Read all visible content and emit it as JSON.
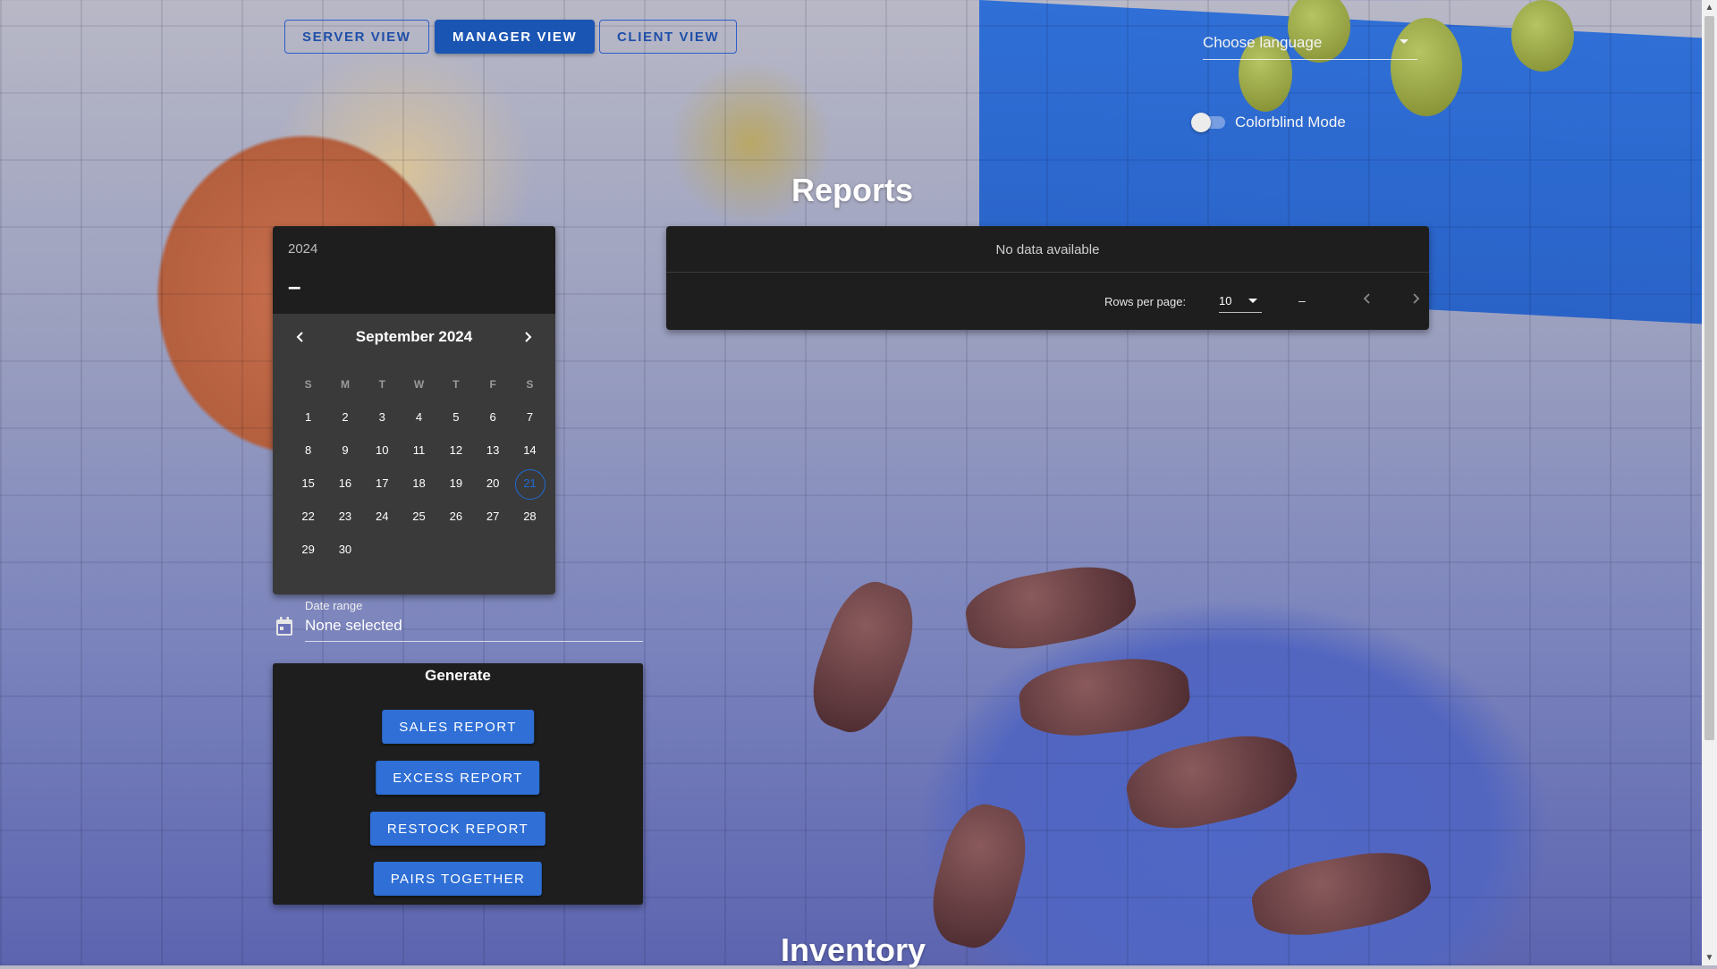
{
  "views": {
    "server": "SERVER VIEW",
    "manager": "MANAGER VIEW",
    "client": "CLIENT VIEW"
  },
  "language": {
    "placeholder": "Choose language"
  },
  "colorblind": {
    "label": "Colorblind Mode",
    "enabled": false
  },
  "reports": {
    "title": "Reports"
  },
  "datepicker": {
    "year": "2024",
    "selected_range": "–",
    "month_label": "September 2024",
    "weekdays": [
      "S",
      "M",
      "T",
      "W",
      "T",
      "F",
      "S"
    ],
    "weeks": [
      [
        "1",
        "2",
        "3",
        "4",
        "5",
        "6",
        "7"
      ],
      [
        "8",
        "9",
        "10",
        "11",
        "12",
        "13",
        "14"
      ],
      [
        "15",
        "16",
        "17",
        "18",
        "19",
        "20",
        "21"
      ],
      [
        "22",
        "23",
        "24",
        "25",
        "26",
        "27",
        "28"
      ],
      [
        "29",
        "30",
        "",
        "",
        "",
        "",
        ""
      ]
    ],
    "today": "21"
  },
  "date_range": {
    "label": "Date range",
    "value": "None selected"
  },
  "generate": {
    "title": "Generate",
    "buttons": [
      "SALES REPORT",
      "EXCESS REPORT",
      "RESTOCK REPORT",
      "PAIRS TOGETHER"
    ]
  },
  "table": {
    "empty_text": "No data available",
    "rows_per_page_label": "Rows per page:",
    "rows_per_page": "10",
    "page_info": "–"
  },
  "inventory": {
    "title": "Inventory"
  },
  "colors": {
    "accent": "#2f6fd6",
    "panel": "#1e1e1e",
    "today_ring": "#1e6bd6"
  }
}
